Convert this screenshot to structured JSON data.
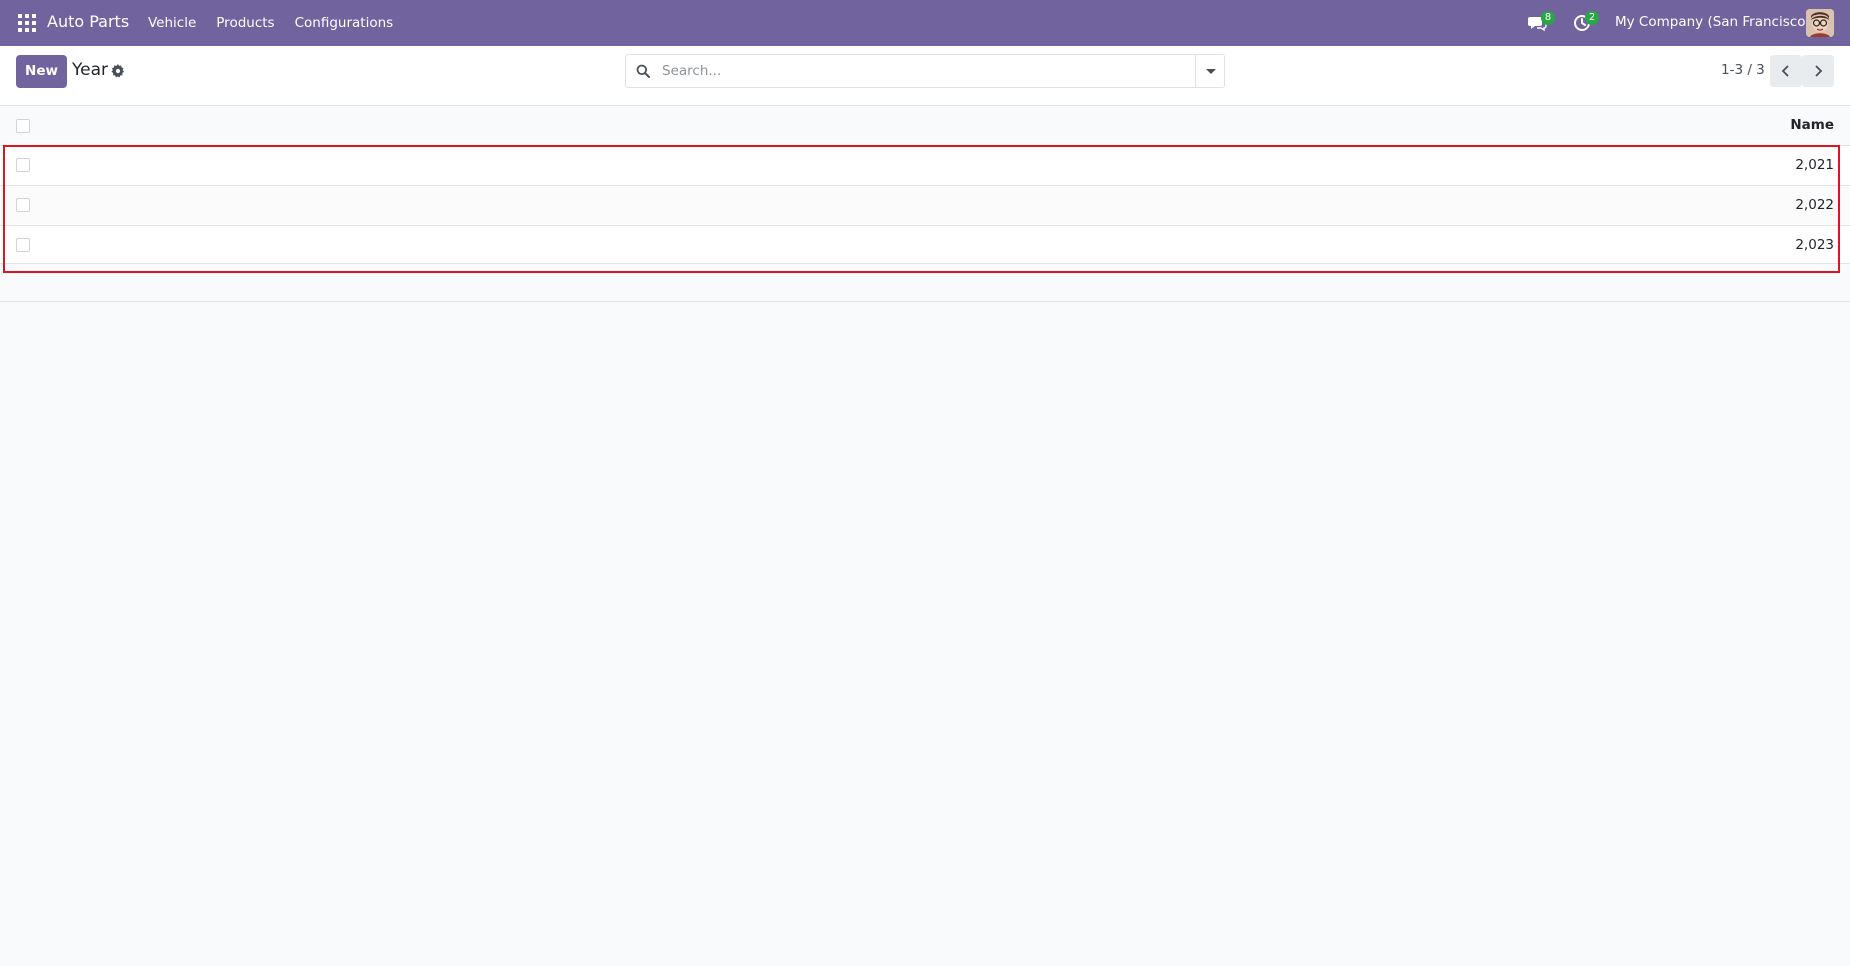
{
  "navbar": {
    "brand": "Auto Parts",
    "menu": [
      "Vehicle",
      "Products",
      "Configurations"
    ],
    "messages_count": "8",
    "activities_count": "2",
    "company": "My Company (San Francisco)"
  },
  "control_panel": {
    "new_label": "New",
    "title": "Year",
    "search_placeholder": "Search...",
    "pager": "1-3 / 3"
  },
  "list": {
    "columns": [
      "Name"
    ],
    "rows": [
      {
        "name": "2,021"
      },
      {
        "name": "2,022"
      },
      {
        "name": "2,023"
      }
    ]
  },
  "colors": {
    "brand": "#71639e",
    "badge": "#28a745",
    "highlight": "#e0141e"
  }
}
